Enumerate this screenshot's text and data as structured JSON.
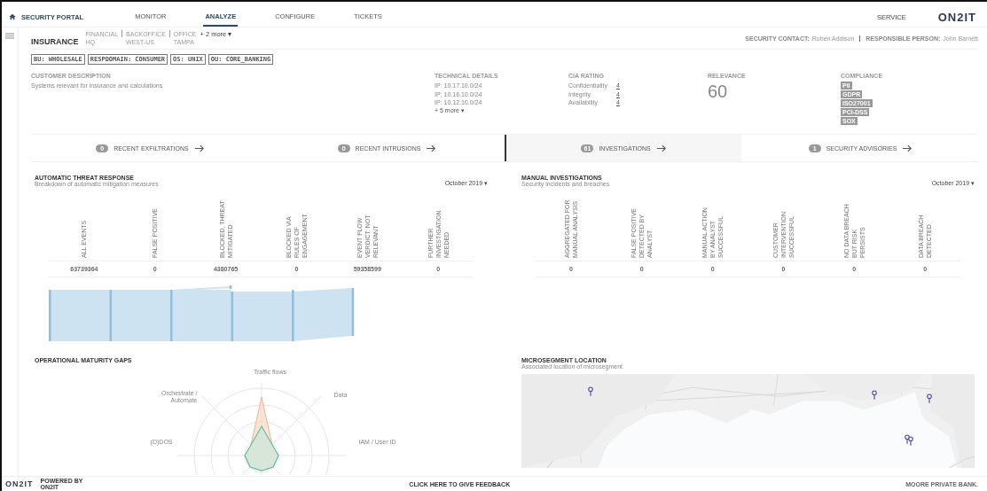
{
  "nav": {
    "brand": "SECURITY PORTAL",
    "tabs": [
      {
        "label": "MONITOR",
        "selected": false
      },
      {
        "label": "ANALYZE",
        "selected": true
      },
      {
        "label": "CONFIGURE",
        "selected": false
      },
      {
        "label": "TICKETS",
        "selected": false
      }
    ],
    "service": "SERVICE",
    "logo": "ON2IT"
  },
  "header": {
    "title": "INSURANCE",
    "locations": [
      {
        "unit": "FINANCIAL",
        "site": "HQ"
      },
      {
        "unit": "BACKOFFICE",
        "site": "WEST-US"
      },
      {
        "unit": "OFFICE",
        "site": "TAMPA"
      }
    ],
    "more": "+ 2 more ▾",
    "security_contact_label": "SECURITY CONTACT:",
    "security_contact": "Ruben Addison",
    "responsible_label": "RESPONSIBLE PERSON:",
    "responsible": "John Barnett"
  },
  "tags": [
    "BU: WHOLESALE",
    "RESPDOMAIN: CONSUMER",
    "OS: UNIX",
    "OU: CORE_BANKING"
  ],
  "description": {
    "label": "CUSTOMER DESCRIPTION",
    "text": "Systems relevant for insurance and calculations"
  },
  "technical": {
    "label": "TECHNICAL DETAILS",
    "ips": [
      "IP: 10.17.10.0/24",
      "IP: 10.16.10.0/24",
      "IP: 10.12.10.0/24"
    ],
    "more": "+ 5 more ▾"
  },
  "cia": {
    "label": "CIA RATING",
    "ratings": [
      {
        "name": "Confidentiality",
        "value": "4"
      },
      {
        "name": "Integrity",
        "value": "4"
      },
      {
        "name": "Availability",
        "value": "4"
      }
    ]
  },
  "relevance": {
    "label": "RELEVANCE",
    "value": "60"
  },
  "compliance": {
    "label": "COMPLIANCE",
    "items": [
      "PII",
      "GDPR",
      "ISO27001",
      "PCI-DSS",
      "SOX"
    ]
  },
  "summary_tabs": [
    {
      "count": "0",
      "label": "RECENT EXFILTRATIONS",
      "selected": false
    },
    {
      "count": "0",
      "label": "RECENT INTRUSIONS",
      "selected": false
    },
    {
      "count": "61",
      "label": "INVESTIGATIONS",
      "selected": true
    },
    {
      "count": "1",
      "label": "SECURITY ADVISORIES",
      "selected": false
    }
  ],
  "automatic": {
    "title": "AUTOMATIC THREAT RESPONSE",
    "subtitle": "Breakdown of automatic mitigation measures",
    "period": "October 2019 ▾",
    "columns": [
      {
        "heading": "ALL EVENTS",
        "value": "63739364"
      },
      {
        "heading": "FALSE POSITIVE",
        "value": "0"
      },
      {
        "heading": "BLOCKED, THREAT MITIGATED",
        "value": "4380765"
      },
      {
        "heading": "BLOCKED VIA RULES OF ENGAGEMENT",
        "value": "0"
      },
      {
        "heading": "EVENT FLOW VERDICT: NOT RELEVANT",
        "value": "59358599"
      },
      {
        "heading": "FURTHER INVESTIGATION NEEDED",
        "value": "0"
      }
    ]
  },
  "manual": {
    "title": "MANUAL INVESTIGATIONS",
    "subtitle": "Security incidents and breaches",
    "period": "October 2019 ▾",
    "columns": [
      {
        "heading": "AGGREGATED FOR MANUAL ANALYSIS",
        "value": "0"
      },
      {
        "heading": "FALSE POSITIVE DETECTED BY ANALYST",
        "value": "0"
      },
      {
        "heading": "MANUAL ACTION BY ANALYST SUCCESSFUL",
        "value": "0"
      },
      {
        "heading": "CUSTOMER INTERVENTION SUCCESSFUL",
        "value": "0"
      },
      {
        "heading": "NO DATA BREACH BUT RISK PERSISTS",
        "value": "0"
      },
      {
        "heading": "DATA BREACH DETECTED",
        "value": "0"
      }
    ]
  },
  "maturity": {
    "title": "OPERATIONAL MATURITY GAPS",
    "axes": [
      "Traffic flows",
      "Data",
      "IAM / User ID",
      "(D)DOS",
      "Orchestrate / Automate"
    ]
  },
  "location": {
    "title": "MICROSEGMENT LOCATION",
    "subtitle": "Associated location of microsegment"
  },
  "footer": {
    "logo": "ON2IT",
    "powered_by": "POWERED BY",
    "brand": "ON2IT",
    "feedback": "CLICK HERE TO GIVE FEEDBACK",
    "client": "MOORE PRIVATE BANK."
  }
}
